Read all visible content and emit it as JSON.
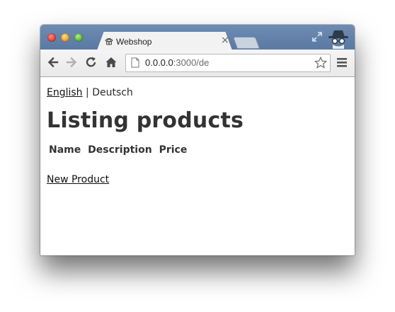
{
  "browser": {
    "tab_title": "Webshop",
    "tab_close": "×",
    "url_host": "0.0.0.0",
    "url_rest": ":3000/de",
    "icons": {
      "back": "back-arrow-icon",
      "forward": "forward-arrow-icon",
      "reload": "reload-icon",
      "home": "home-icon",
      "page": "page-icon",
      "bookmark": "star-icon",
      "menu": "menu-icon",
      "fullscreen": "fullscreen-icon",
      "incognito": "incognito-icon"
    }
  },
  "page": {
    "lang_links": {
      "english": "English",
      "separator": "|",
      "deutsch": "Deutsch"
    },
    "heading": "Listing products",
    "table_headers": [
      "Name",
      "Description",
      "Price"
    ],
    "new_product_link": "New Product"
  }
}
